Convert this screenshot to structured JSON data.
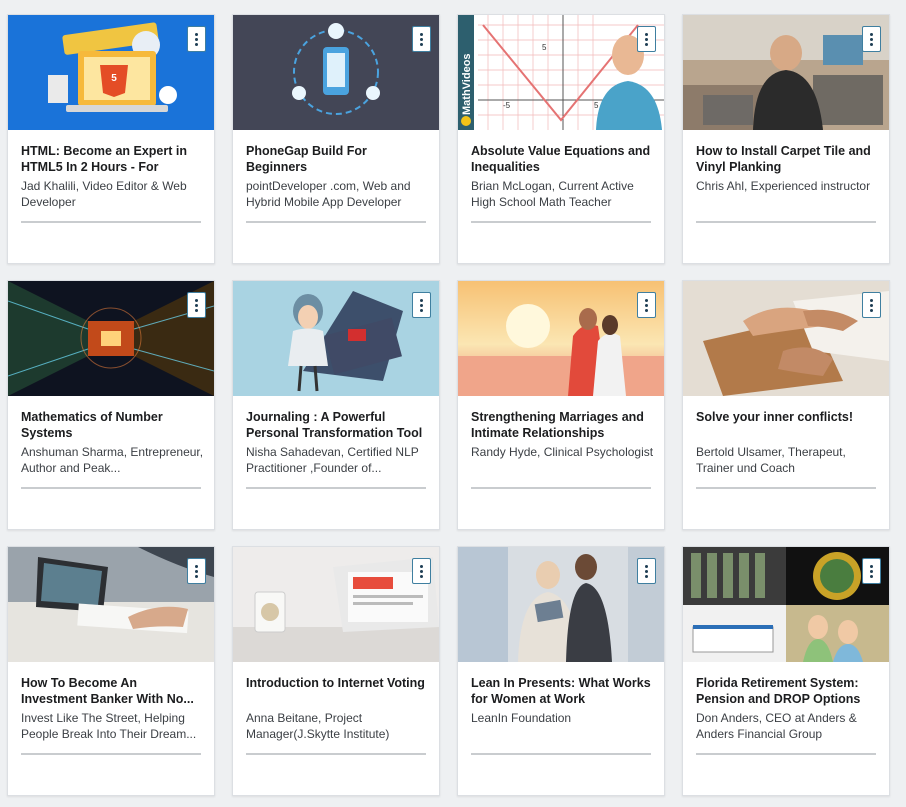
{
  "courses": [
    {
      "title": "HTML: Become an Expert in HTML5 In 2 Hours - For",
      "instructor": "Jad Khalili, Video Editor & Web Developer",
      "thumb": "html5-laptop-thumbnail"
    },
    {
      "title": "PhoneGap Build For Beginners",
      "instructor": "pointDeveloper .com, Web and Hybrid Mobile App Developer",
      "thumb": "phonegap-phone-thumbnail"
    },
    {
      "title": "Absolute Value Equations and Inequalities",
      "instructor": "Brian McLogan, Current Active High School Math Teacher",
      "thumb": "math-graph-thumbnail",
      "thumb_text": "MathVideos",
      "axis_labels": [
        "5",
        "-5",
        "5"
      ]
    },
    {
      "title": "How to Install Carpet Tile and Vinyl Planking",
      "instructor": "Chris Ahl, Experienced instructor",
      "thumb": "flooring-thumbnail"
    },
    {
      "title": "Mathematics of Number Systems",
      "instructor": "Anshuman Sharma, Entrepreneur, Author and Peak...",
      "thumb": "digital-tunnel-thumbnail"
    },
    {
      "title": "Journaling : A Powerful Personal Transformation Tool",
      "instructor": "Nisha Sahadevan, Certified NLP Practitioner ,Founder of...",
      "thumb": "journal-illustration-thumbnail"
    },
    {
      "title": "Strengthening Marriages and Intimate Relationships",
      "instructor": "Randy Hyde, Clinical Psychologist",
      "thumb": "couple-sunset-thumbnail"
    },
    {
      "title": "Solve your inner conflicts!",
      "instructor": "Bertold Ulsamer, Therapeut, Trainer und Coach",
      "thumb": "handshake-thumbnail"
    },
    {
      "title": "How To Become An Investment Banker With No...",
      "instructor": "Invest Like The Street, Helping People Break Into Their Dream...",
      "thumb": "office-desk-thumbnail"
    },
    {
      "title": "Introduction to Internet Voting",
      "instructor": "Anna Beitane, Project Manager(J.Skytte Institute)",
      "thumb": "laptop-mug-thumbnail"
    },
    {
      "title": "Lean In Presents: What Works for Women at Work",
      "instructor": "LeanIn Foundation",
      "thumb": "businesswomen-thumbnail"
    },
    {
      "title": "Florida Retirement System: Pension and DROP Options",
      "instructor": "Don Anders, CEO at Anders & Anders Financial Group",
      "thumb": "florida-collage-thumbnail"
    }
  ],
  "colors": {
    "background": "#eef0f2",
    "card": "#ffffff",
    "menu_border": "#3f7fa0",
    "title": "#1c1d1f"
  },
  "icons": {
    "card_menu": "kebab-menu-icon"
  }
}
